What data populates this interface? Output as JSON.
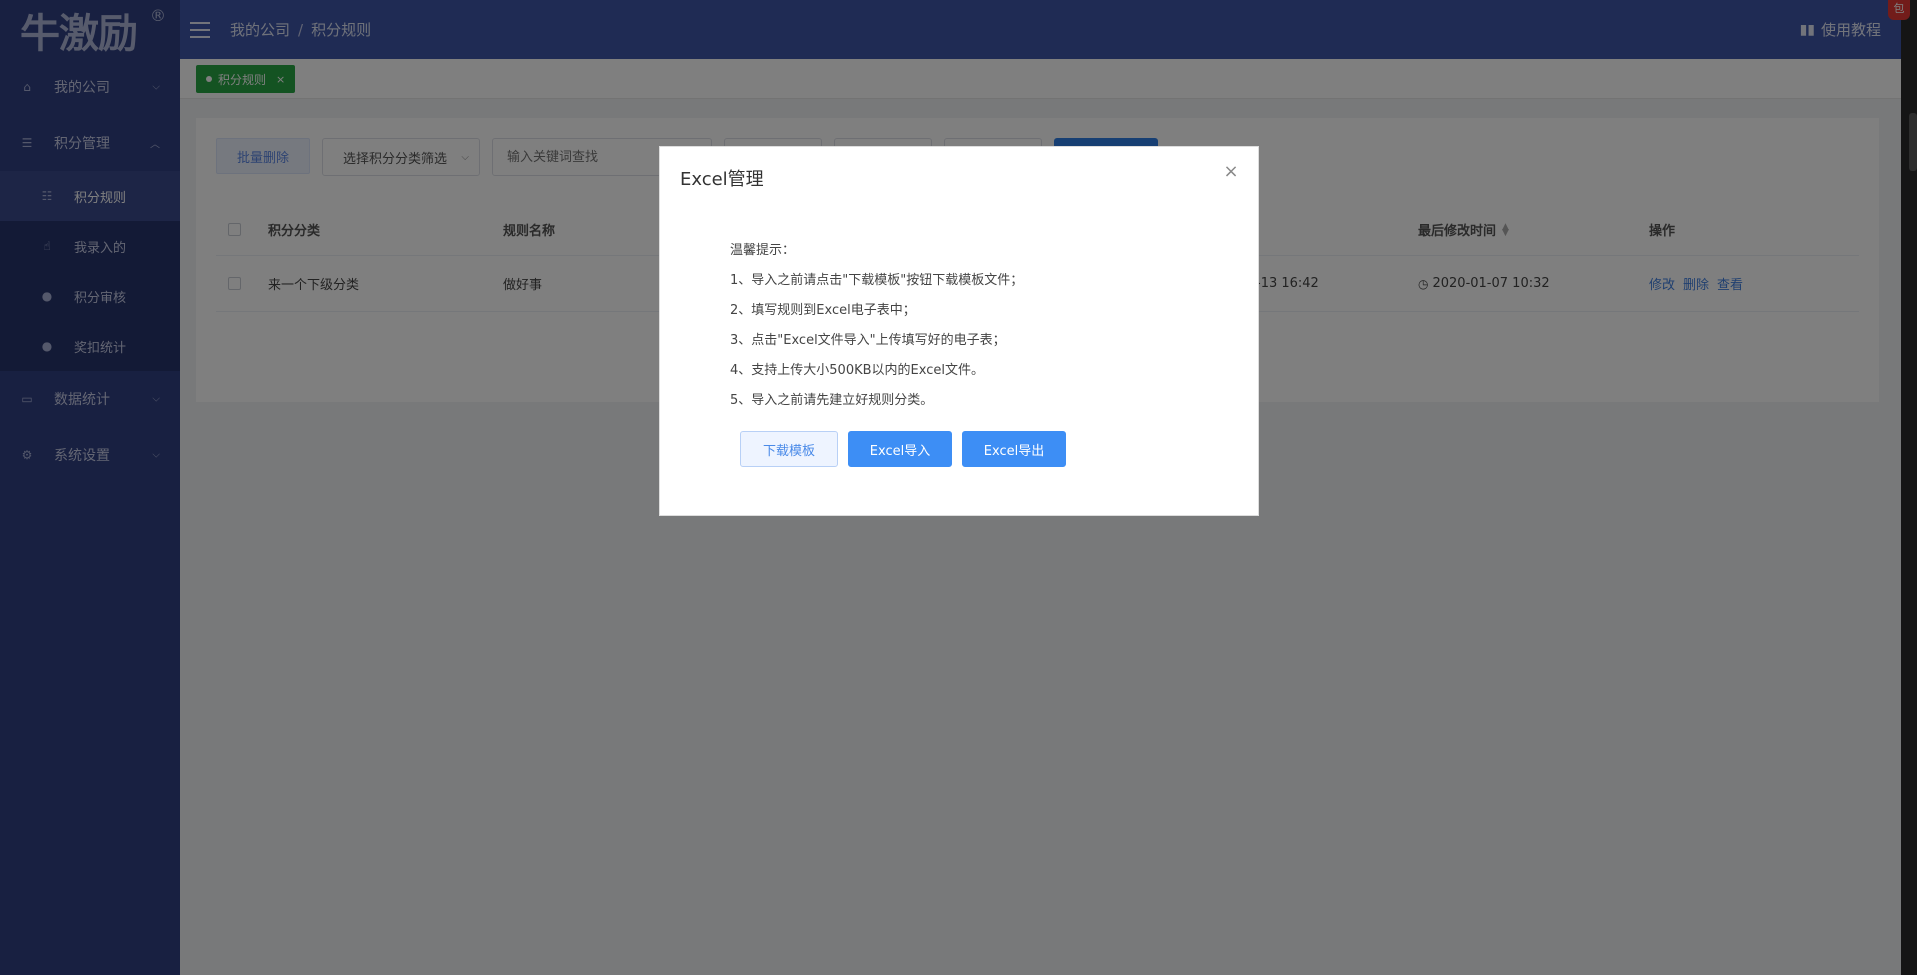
{
  "sidebar": {
    "logo": "牛激励",
    "logo_reg": "®",
    "menu": [
      {
        "label": "我的公司",
        "icon": "company-icon"
      },
      {
        "label": "积分管理",
        "icon": "database-icon"
      },
      {
        "label": "数据统计",
        "icon": "monitor-icon"
      },
      {
        "label": "系统设置",
        "icon": "gear-icon"
      }
    ],
    "submenu": [
      {
        "label": "积分规则",
        "icon": "list-icon"
      },
      {
        "label": "我录入的",
        "icon": "hand-pointer-icon"
      },
      {
        "label": "积分审核",
        "icon": "user-icon"
      },
      {
        "label": "奖扣统计",
        "icon": "user-icon"
      }
    ]
  },
  "header": {
    "breadcrumb": [
      "我的公司",
      "积分规则"
    ],
    "breadcrumb_sep": "/",
    "help": "使用教程",
    "badge": "包"
  },
  "tabs": [
    {
      "label": "积分规则",
      "close": "×"
    }
  ],
  "toolbar": {
    "batch_delete": "批量删除",
    "category_select": "选择积分分类筛选",
    "keyword_placeholder": "输入关键词查找"
  },
  "table": {
    "headers": {
      "category": "积分分类",
      "name": "规则名称",
      "modified": "最后修改时间",
      "actions": "操作"
    },
    "rows": [
      {
        "category": "来一个下级分类",
        "name": "做好事",
        "created_partial": "-13 16:42",
        "modified": "2020-01-07 10:32",
        "actions": [
          "修改",
          "删除",
          "查看"
        ]
      }
    ]
  },
  "modal": {
    "title": "Excel管理",
    "close": "×",
    "tips_title": "温馨提示：",
    "tips": [
      "1、导入之前请点击\"下载模板\"按钮下载模板文件；",
      "2、填写规则到Excel电子表中；",
      "3、点击\"Excel文件导入\"上传填写好的电子表；",
      "4、支持上传大小500KB以内的Excel文件。",
      "5、导入之前请先建立好规则分类。"
    ],
    "buttons": {
      "download": "下载模板",
      "import": "Excel导入",
      "export": "Excel导出"
    }
  }
}
